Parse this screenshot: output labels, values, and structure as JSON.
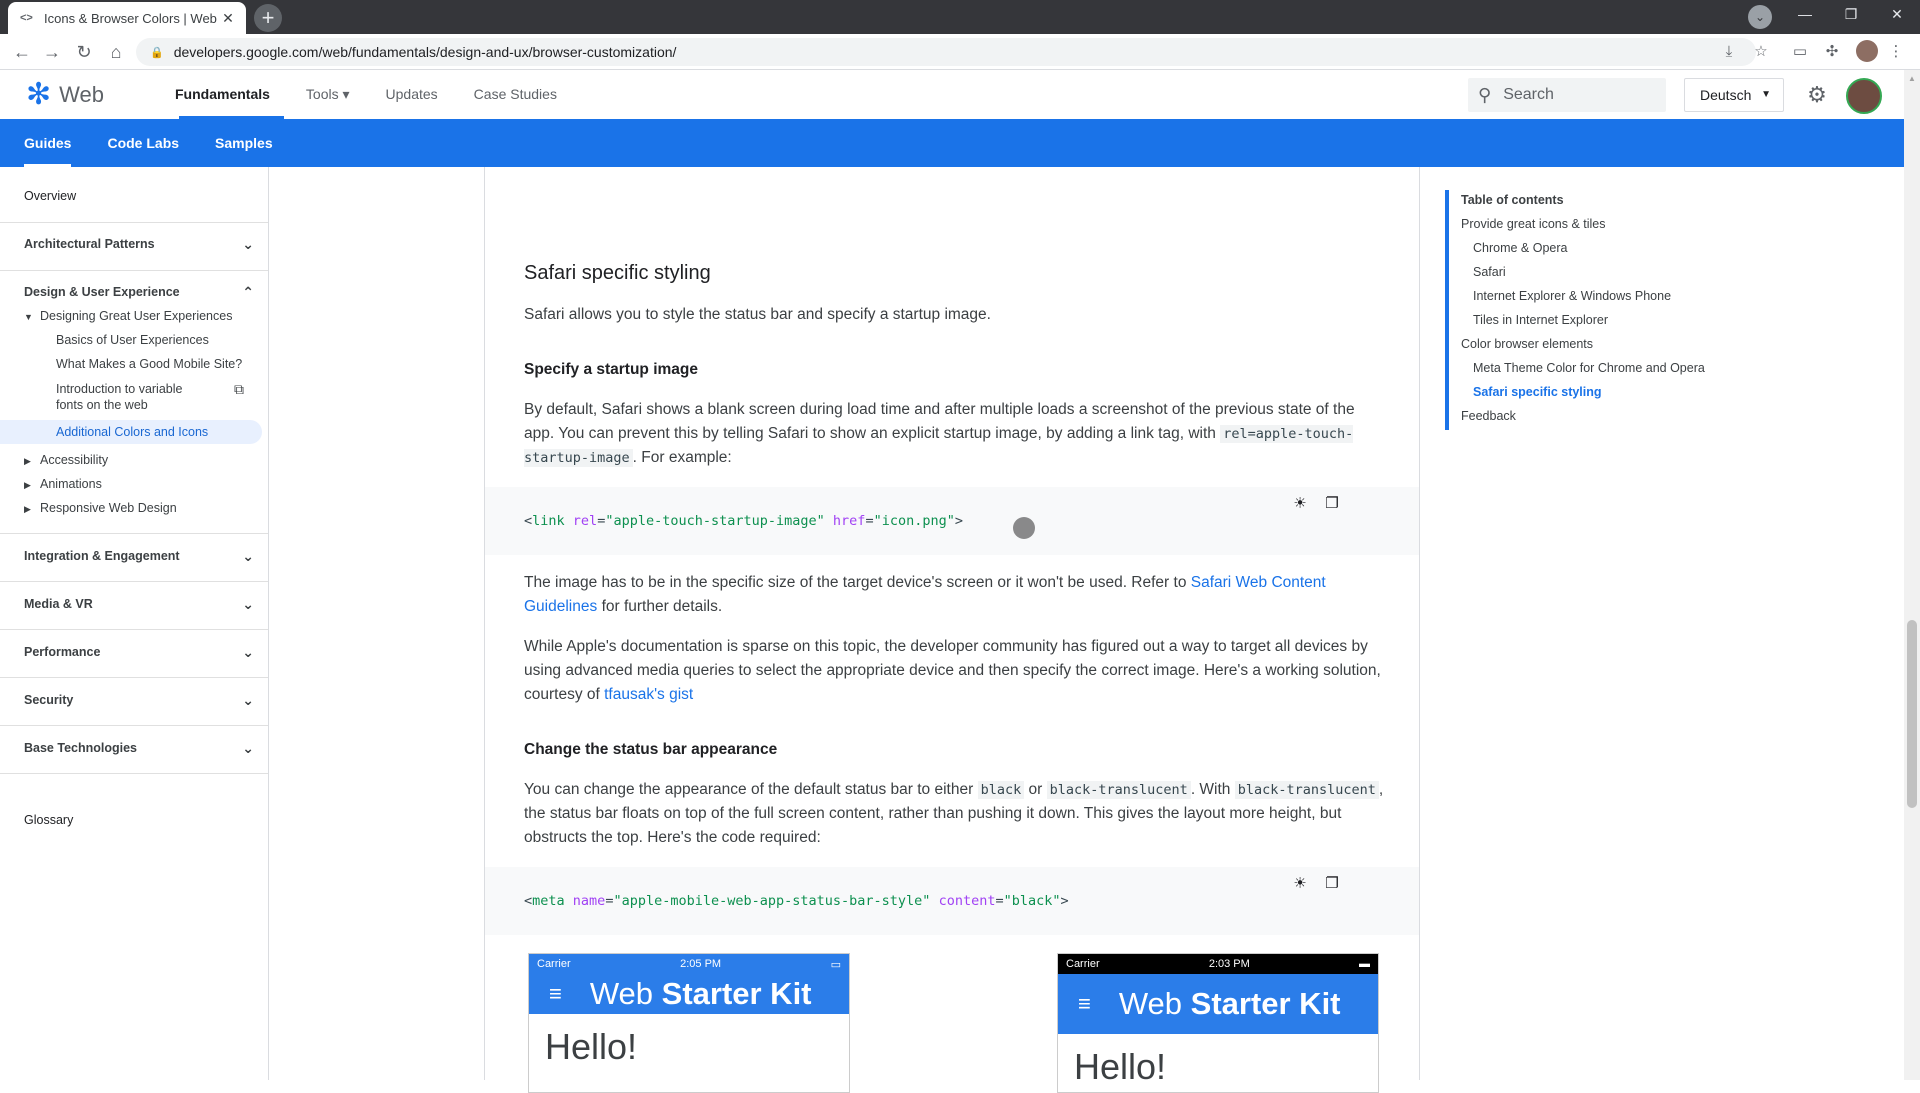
{
  "browser": {
    "tab_title": "Icons & Browser Colors  |  Web F",
    "tab_favicon": "<>",
    "url": "developers.google.com/web/fundamentals/design-and-ux/browser-customization/",
    "profile_initial": "⌄"
  },
  "header": {
    "logo_text": "Web",
    "nav": [
      {
        "label": "Fundamentals",
        "active": true
      },
      {
        "label": "Tools ▾",
        "active": false
      },
      {
        "label": "Updates",
        "active": false
      },
      {
        "label": "Case Studies",
        "active": false
      }
    ],
    "search_placeholder": "Search",
    "language": "Deutsch"
  },
  "tabs": [
    {
      "label": "Guides",
      "active": true
    },
    {
      "label": "Code Labs",
      "active": false
    },
    {
      "label": "Samples",
      "active": false
    }
  ],
  "sidebar": {
    "overview": "Overview",
    "sections": [
      "Architectural Patterns",
      "Design & User Experience",
      "Integration & Engagement",
      "Media & VR",
      "Performance",
      "Security",
      "Base Technologies"
    ],
    "designing_group": "Designing Great User Experiences",
    "designing_items": [
      "Basics of User Experiences",
      "What Makes a Good Mobile Site?",
      "Introduction to variable fonts on the web",
      "Additional Colors and Icons"
    ],
    "collapsed_groups": [
      "Accessibility",
      "Animations",
      "Responsive Web Design"
    ],
    "glossary": "Glossary"
  },
  "article": {
    "h2_safari": "Safari specific styling",
    "p_safari_intro": "Safari allows you to style the status bar and specify a startup image.",
    "h3_startup": "Specify a startup image",
    "p_startup_1": "By default, Safari shows a blank screen during load time and after multiple loads a screenshot of the previous state of the app. You can prevent this by telling Safari to show an explicit startup image, by adding a link tag, with",
    "code_rel": "rel=apple-touch-startup-image",
    "p_startup_1_end": ". For example:",
    "code1": {
      "tag": "link",
      "attr1": "rel",
      "val1": "\"apple-touch-startup-image\"",
      "attr2": "href",
      "val2": "\"icon.png\""
    },
    "p_startup_2": "The image has to be in the specific size of the target device's screen or it won't be used. Refer to",
    "link_guidelines": "Safari Web Content Guidelines",
    "p_startup_2_end": "for further details.",
    "p_startup_3": "While Apple's documentation is sparse on this topic, the developer community has figured out a way to target all devices by using advanced media queries to select the appropriate device and then specify the correct image. Here's a working solution, courtesy of",
    "link_gist": "tfausak's gist",
    "h3_statusbar": "Change the status bar appearance",
    "p_status_1": "You can change the appearance of the default status bar to either",
    "code_black": "black",
    "p_status_or": "or",
    "code_black_translucent": "black-translucent",
    "p_status_with": ". With",
    "code_black_translucent2": "black-translucent",
    "p_status_rest": ", the status bar floats on top of the full screen content, rather than pushing it down. This gives the layout more height, but obstructs the top. Here's the code required:",
    "code2": {
      "tag": "meta",
      "attr1": "name",
      "val1": "\"apple-mobile-web-app-status-bar-style\"",
      "attr2": "content",
      "val2": "\"black\""
    }
  },
  "phones": [
    {
      "carrier": "Carrier",
      "time": "2:05 PM",
      "title_light": "Web ",
      "title_bold": "Starter Kit",
      "hello": "Hello!",
      "status_bg": "#2b7de9",
      "status_fg": "#ffffff"
    },
    {
      "carrier": "Carrier",
      "time": "2:03 PM",
      "title_light": "Web ",
      "title_bold": "Starter Kit",
      "hello": "Hello!",
      "status_bg": "#000000",
      "status_fg": "#ffffff"
    }
  ],
  "toc": {
    "heading": "Table of contents",
    "items": [
      {
        "label": "Provide great icons & tiles",
        "level": 1,
        "current": false
      },
      {
        "label": "Chrome & Opera",
        "level": 2,
        "current": false
      },
      {
        "label": "Safari",
        "level": 2,
        "current": false
      },
      {
        "label": "Internet Explorer & Windows Phone",
        "level": 2,
        "current": false
      },
      {
        "label": "Tiles in Internet Explorer",
        "level": 2,
        "current": false
      },
      {
        "label": "Color browser elements",
        "level": 1,
        "current": false
      },
      {
        "label": "Meta Theme Color for Chrome and Opera",
        "level": 2,
        "current": false
      },
      {
        "label": "Safari specific styling",
        "level": 2,
        "current": true
      },
      {
        "label": "Feedback",
        "level": 1,
        "current": false
      }
    ]
  },
  "colors": {
    "accent": "#1a73e8",
    "tabbar": "#1a73e8",
    "chrome_dark": "#35363a"
  }
}
